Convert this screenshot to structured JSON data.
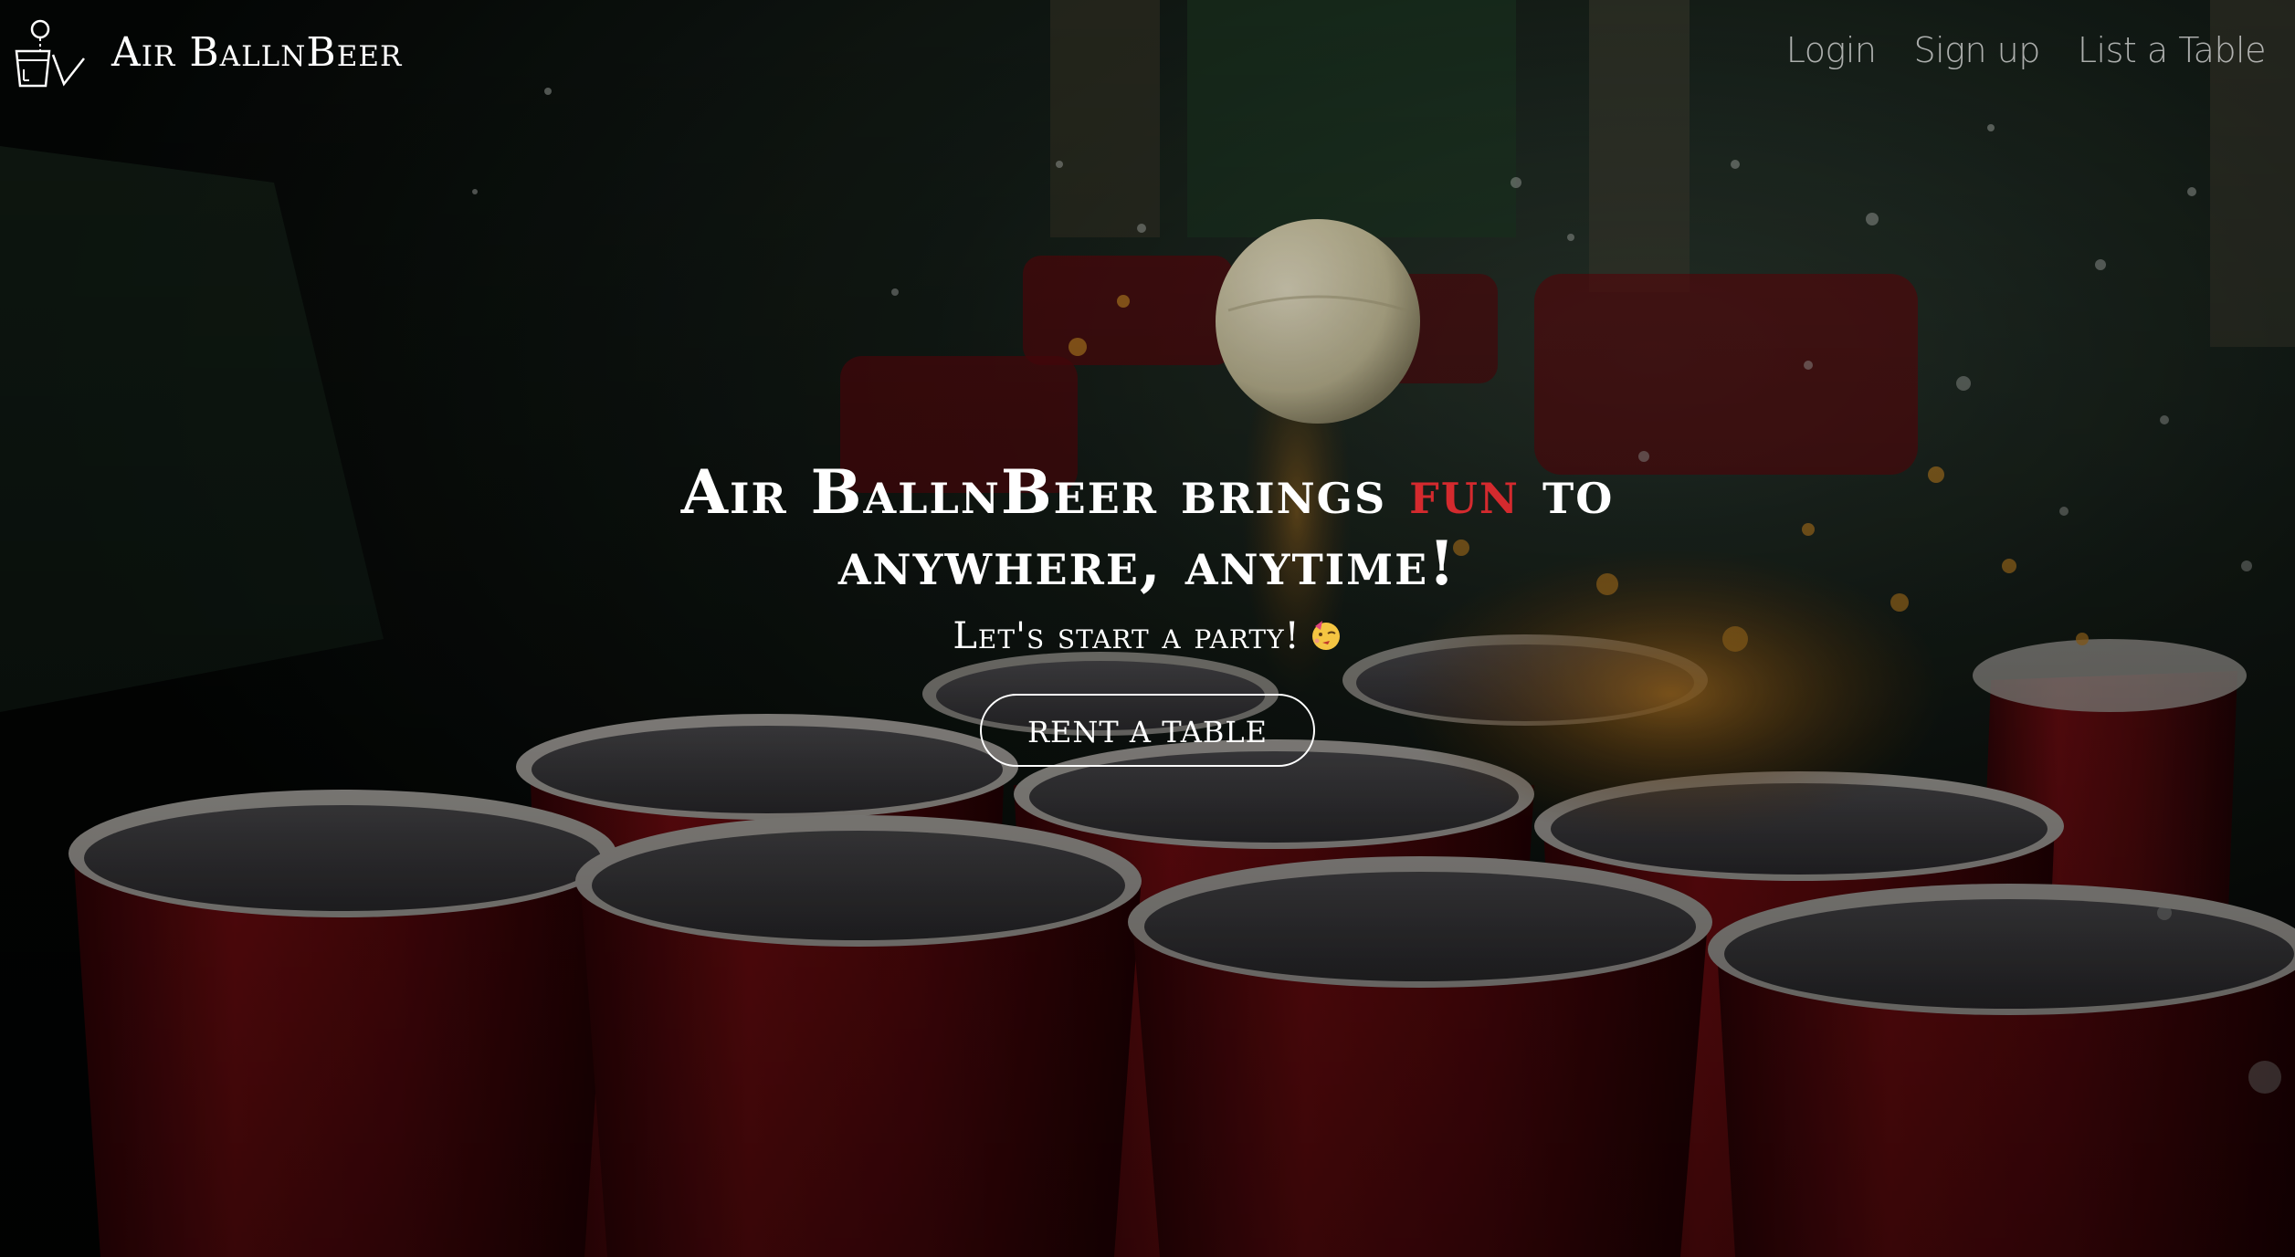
{
  "brand": {
    "name": "Air BallnBeer",
    "logo_icon": "cup-and-ball-logo-icon"
  },
  "nav": {
    "links": [
      {
        "label": "Login"
      },
      {
        "label": "Sign up"
      },
      {
        "label": "List a Table"
      }
    ]
  },
  "hero": {
    "title_part1": "Air BallnBeer brings ",
    "title_accent": "fun",
    "title_part2": " to anywhere, anytime!",
    "subtitle": "Let's start a party!",
    "subtitle_emoji_icon": "partying-face-icon",
    "cta_label": "RENT A TABLE",
    "background": "beer-pong-cups-photo"
  },
  "colors": {
    "accent": "#d42a2e",
    "text": "#ffffff",
    "nav_text": "#e8e8e8",
    "cup_red": "#8a0d12"
  }
}
